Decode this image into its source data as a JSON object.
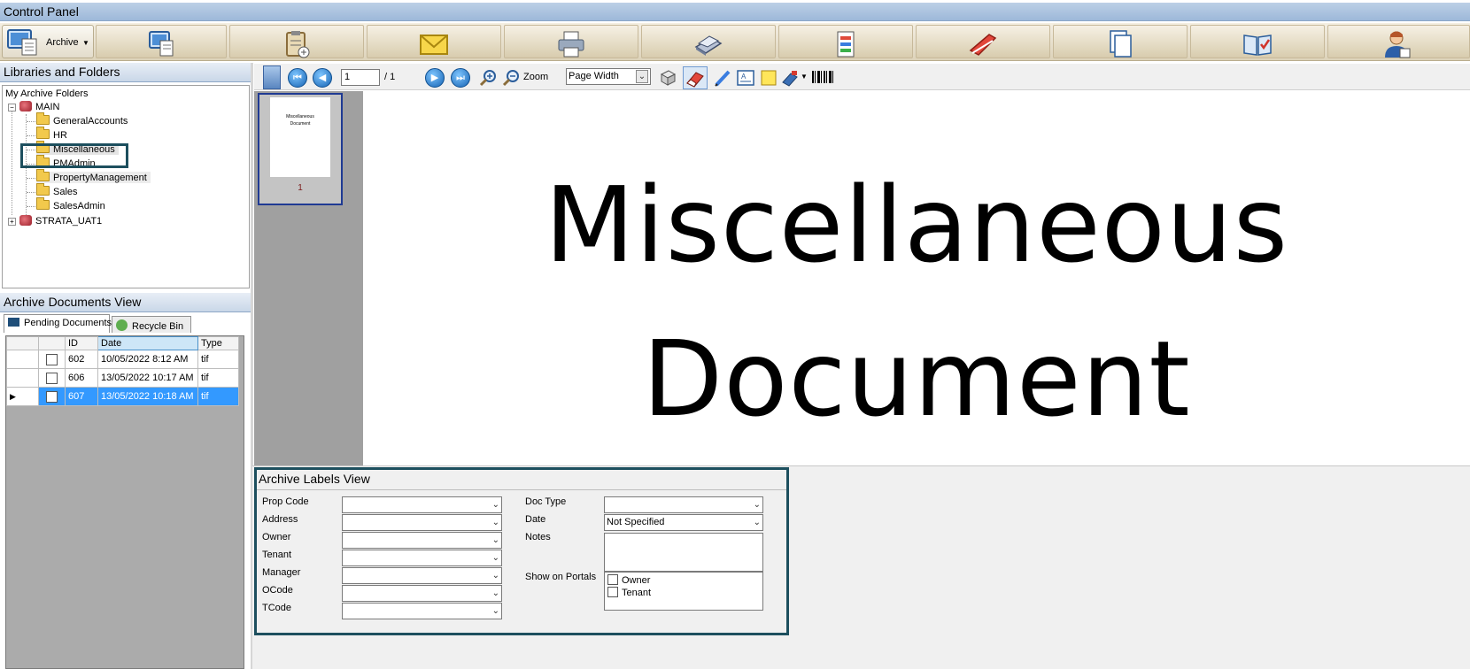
{
  "window": {
    "title": "Control Panel"
  },
  "toolbar": {
    "archive_label": "Archive",
    "icons": [
      "computer-icon",
      "clipboard-icon",
      "envelope-icon",
      "printer-icon",
      "scanner-icon",
      "export-icon",
      "stapler-icon",
      "copy-pages-icon",
      "book-check-icon",
      "user-icon"
    ]
  },
  "libraries": {
    "header": "Libraries and Folders",
    "root_label": "My Archive Folders",
    "main": "MAIN",
    "folders": [
      "GeneralAccounts",
      "HR",
      "Miscellaneous",
      "PMAdmin",
      "PropertyManagement",
      "Sales",
      "SalesAdmin"
    ],
    "second_library": "STRATA_UAT1"
  },
  "archive_docs": {
    "header": "Archive Documents View",
    "tabs": [
      "Pending Documents",
      "Recycle Bin"
    ],
    "columns": [
      "ID",
      "Date",
      "Type"
    ],
    "rows": [
      {
        "id": "602",
        "date": "10/05/2022 8:12 AM",
        "type": "tif"
      },
      {
        "id": "606",
        "date": "13/05/2022 10:17 AM",
        "type": "tif"
      },
      {
        "id": "607",
        "date": "13/05/2022 10:18 AM",
        "type": "tif"
      }
    ]
  },
  "viewer": {
    "page_input": "1",
    "page_total": "/ 1",
    "zoom_label": "Zoom",
    "zoom_value": "Page Width",
    "thumb_text_1": "Miscellaneous",
    "thumb_text_2": "Document",
    "thumb_page_number": "1",
    "doc_line_1": "Miscellaneous",
    "doc_line_2": "Document"
  },
  "labels": {
    "header": "Archive Labels View",
    "left_fields": [
      "Prop Code",
      "Address",
      "Owner",
      "Tenant",
      "Manager",
      "OCode",
      "TCode"
    ],
    "doc_type_label": "Doc Type",
    "date_label": "Date",
    "date_value": "Not Specified",
    "notes_label": "Notes",
    "portals_label": "Show on Portals",
    "portal_options": [
      "Owner",
      "Tenant"
    ]
  },
  "colors": {
    "selection": "#3399ff",
    "highlight_box": "#1d4f5e",
    "title_bar": "#9db8d9"
  }
}
